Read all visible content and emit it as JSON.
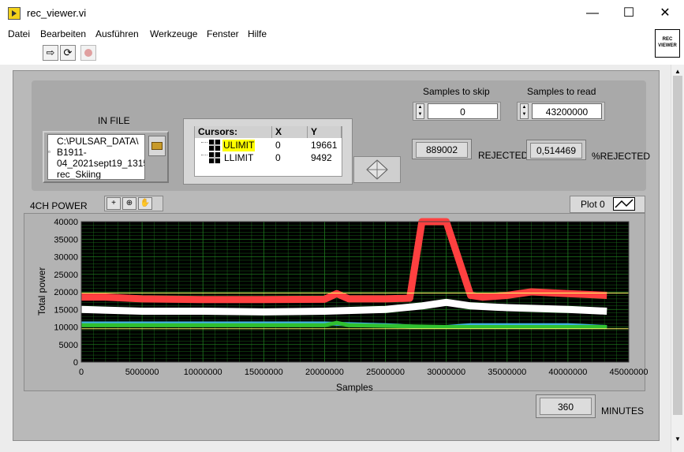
{
  "window": {
    "title": "rec_viewer.vi",
    "controls": {
      "minimize": "—",
      "maximize": "☐",
      "close": "✕"
    }
  },
  "menu": {
    "items": [
      "Datei",
      "Bearbeiten",
      "Ausführen",
      "Werkzeuge",
      "Fenster",
      "Hilfe"
    ]
  },
  "toolbar": {
    "run_icon": "run-arrow-icon",
    "continuous_icon": "run-continuously-icon",
    "abort_icon": "abort-icon"
  },
  "logo": {
    "line1": "REC",
    "line2": "VIEWER"
  },
  "infile": {
    "label": "IN FILE",
    "path_lines": [
      "C:\\PULSAR_DATA\\",
      "B1911-",
      "04_2021sept19_1315",
      "rec_Skiing"
    ]
  },
  "cursors": {
    "headers": [
      "Cursors:",
      "X",
      "Y"
    ],
    "rows": [
      {
        "name": "ULIMIT",
        "x": "0",
        "y": "19661"
      },
      {
        "name": "LLIMIT",
        "x": "0",
        "y": "9492"
      }
    ],
    "highlight_color": "#ffff00"
  },
  "skip": {
    "label": "Samples to skip",
    "value": "0"
  },
  "read": {
    "label": "Samples to read",
    "value": "43200000"
  },
  "rejected": {
    "value": "889002",
    "label": "REJECTED"
  },
  "pct_rejected": {
    "value": "0,514469",
    "label": "%REJECTED"
  },
  "graph": {
    "name": "4CH POWER",
    "plot_legend": "Plot 0",
    "palette_icons": [
      "cursor-move-icon",
      "zoom-icon",
      "pan-hand-icon"
    ]
  },
  "minutes": {
    "value": "360",
    "label": "MINUTES"
  },
  "chart_data": {
    "type": "line",
    "title": "",
    "xlabel": "Samples",
    "ylabel": "Total power",
    "xlim": [
      0,
      45000000
    ],
    "ylim": [
      0,
      40000
    ],
    "x_ticks": [
      "0",
      "5000000",
      "10000000",
      "15000000",
      "20000000",
      "25000000",
      "30000000",
      "35000000",
      "40000000",
      "45000000"
    ],
    "y_ticks": [
      "0",
      "5000",
      "10000",
      "15000",
      "20000",
      "25000",
      "30000",
      "35000",
      "40000"
    ],
    "grid": true,
    "background": "#000000",
    "grid_color": "#1f7a1f",
    "cursor_lines": [
      {
        "name": "ULIMIT",
        "y": 19661,
        "color": "#ffff66"
      },
      {
        "name": "LLIMIT",
        "y": 9492,
        "color": "#ffff66"
      }
    ],
    "series": [
      {
        "color": "#ff4040",
        "x": [
          0,
          2000000,
          5000000,
          10000000,
          15000000,
          20000000,
          21000000,
          22000000,
          25000000,
          27000000,
          28000000,
          30000000,
          32000000,
          33000000,
          35000000,
          37000000,
          40000000,
          43200000
        ],
        "y": [
          18500,
          18500,
          18000,
          17800,
          17800,
          17900,
          19500,
          18000,
          18000,
          18200,
          40000,
          40000,
          19000,
          18500,
          19000,
          20000,
          19500,
          19000
        ]
      },
      {
        "color": "#ffffff",
        "x": [
          0,
          5000000,
          10000000,
          15000000,
          20000000,
          25000000,
          28000000,
          30000000,
          32000000,
          35000000,
          40000000,
          43200000
        ],
        "y": [
          15000,
          14500,
          14500,
          14300,
          14500,
          15000,
          16000,
          17000,
          16000,
          15500,
          15000,
          14500
        ]
      },
      {
        "color": "#40b0e0",
        "x": [
          0,
          5000000,
          10000000,
          15000000,
          20000000,
          25000000,
          28000000,
          30000000,
          32000000,
          35000000,
          40000000,
          43200000
        ],
        "y": [
          11000,
          11000,
          11000,
          11000,
          11000,
          10500,
          10000,
          10000,
          10500,
          10500,
          10500,
          10000
        ]
      },
      {
        "color": "#30c030",
        "x": [
          0,
          10000000,
          20000000,
          21000000,
          22000000,
          30000000,
          40000000,
          43200000
        ],
        "y": [
          10500,
          10500,
          10500,
          11200,
          10500,
          10000,
          10000,
          10000
        ]
      }
    ]
  }
}
